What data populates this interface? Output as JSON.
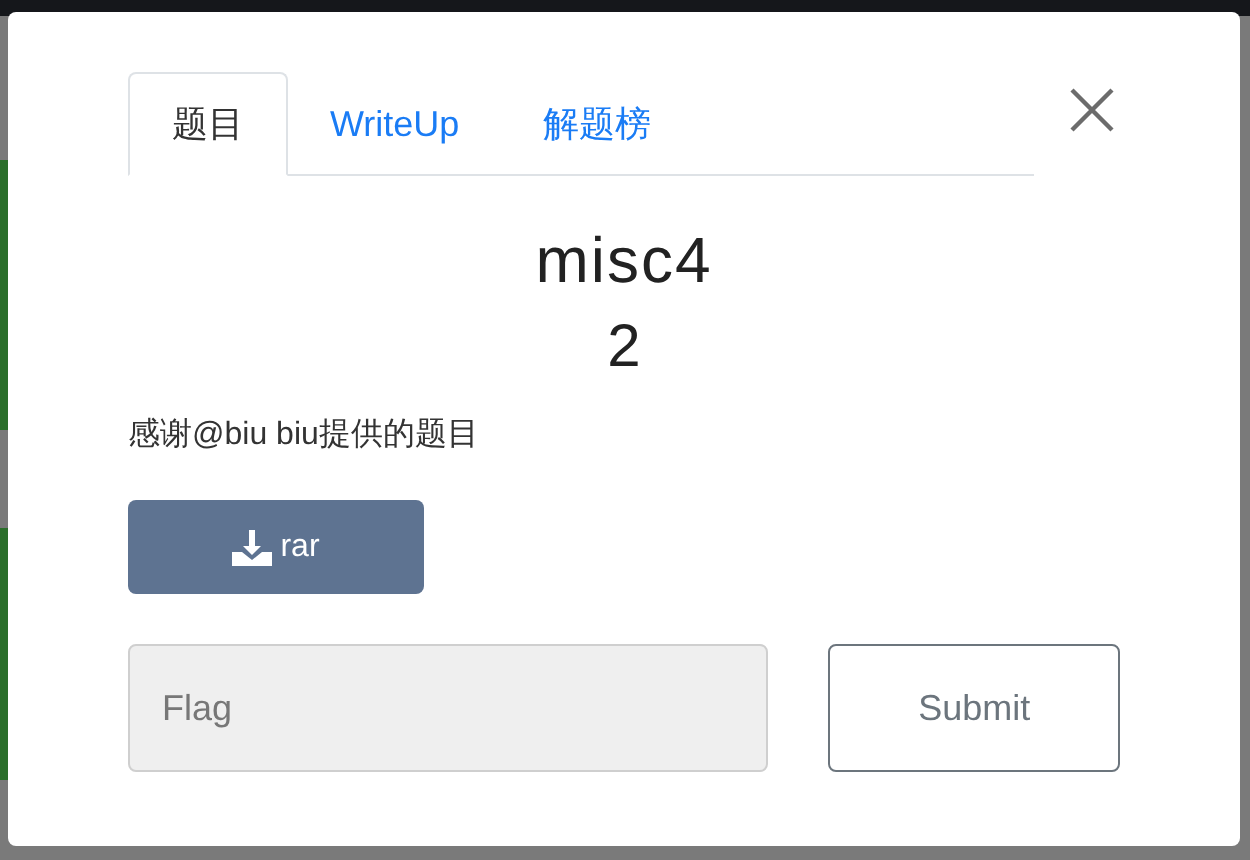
{
  "tabs": [
    {
      "label": "题目",
      "selected": true
    },
    {
      "label": "WriteUp",
      "selected": false
    },
    {
      "label": "解题榜",
      "selected": false
    }
  ],
  "challenge": {
    "name": "misc4",
    "points": "2",
    "description": "感谢@biu biu提供的题目"
  },
  "download": {
    "label": "rar"
  },
  "flag": {
    "placeholder": "Flag"
  },
  "submit": {
    "label": "Submit"
  }
}
